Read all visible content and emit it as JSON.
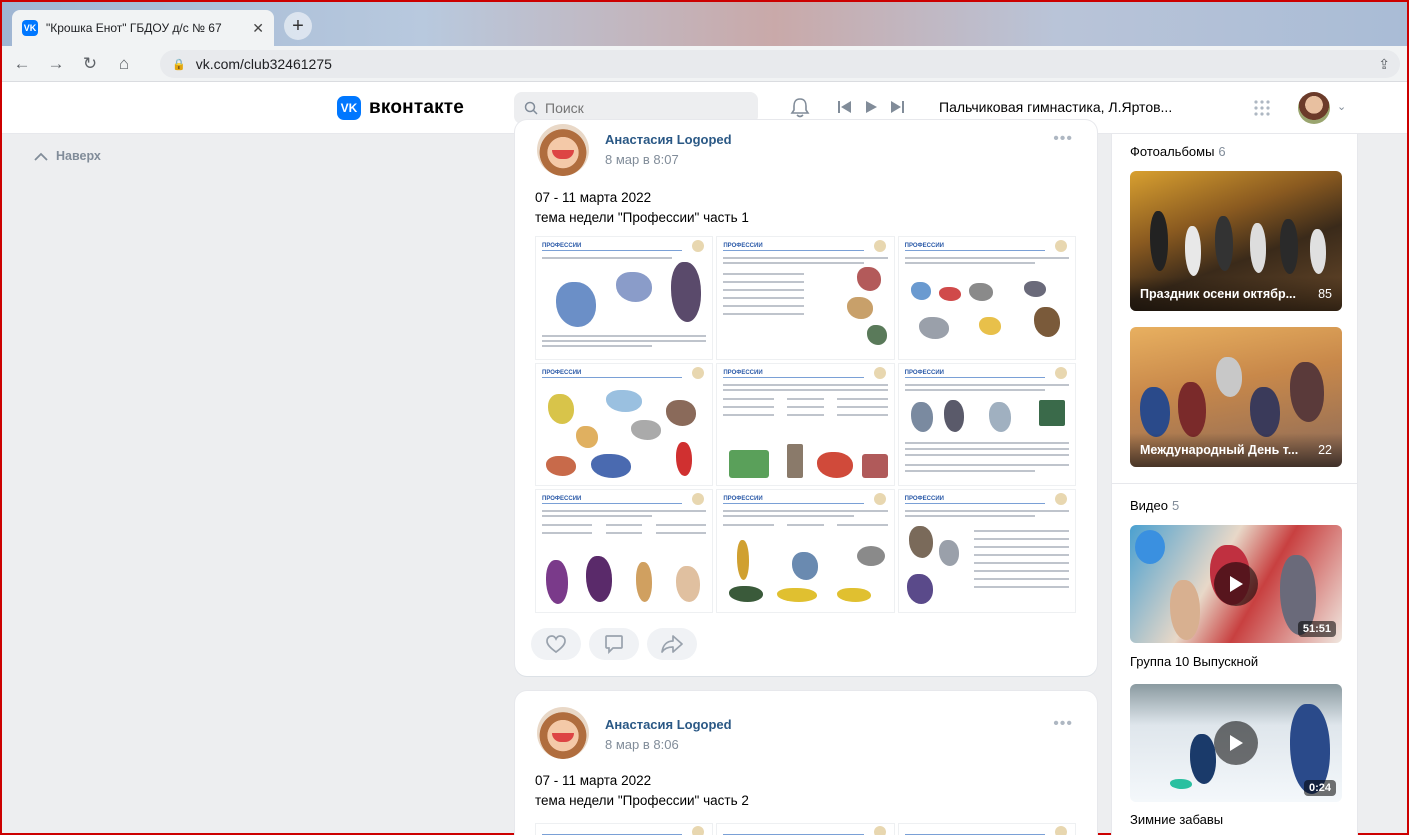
{
  "browser": {
    "tab_title": "\"Крошка Енот\" ГБДОУ д/с № 67",
    "tab_favicon": "VK",
    "url": "vk.com/club32461275"
  },
  "header": {
    "logo_text": "вконтакте",
    "logo_mark": "VK",
    "search_placeholder": "Поиск",
    "now_playing": "Пальчиковая гимнастика, Л.Яртов..."
  },
  "sidebar": {
    "back_to_top": "Наверх"
  },
  "posts": [
    {
      "author": "Анастасия Logoped",
      "date": "8 мар в 8:07",
      "text_line1": "07 - 11 марта 2022",
      "text_line2": "тема недели \"Профессии\" часть 1",
      "sheet_title": "ПРОФЕССИИ"
    },
    {
      "author": "Анастасия Logoped",
      "date": "8 мар в 8:06",
      "text_line1": "07 - 11 марта 2022",
      "text_line2": "тема недели \"Профессии\" часть 2"
    }
  ],
  "right": {
    "albums_title": "Фотоальбомы",
    "albums_count": "6",
    "albums": [
      {
        "name": "Праздник осени октябр...",
        "count": "85"
      },
      {
        "name": "Международный День т...",
        "count": "22"
      }
    ],
    "videos_title": "Видео",
    "videos_count": "5",
    "videos": [
      {
        "name": "Группа 10 Выпускной",
        "duration": "51:51"
      },
      {
        "name": "Зимние забавы",
        "duration": "0:24"
      }
    ]
  },
  "colors": {
    "accent": "#0077ff",
    "link": "#2a5885",
    "muted": "#818c99",
    "page_bg": "#edeef0"
  }
}
